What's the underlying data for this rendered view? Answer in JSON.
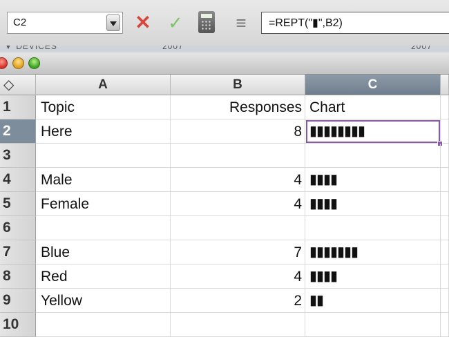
{
  "formula_bar": {
    "name_box_value": "C2",
    "formula": "=REPT(\"▮\",B2)"
  },
  "background_window": {
    "peek_left": "▼ DEVICES",
    "peek_mid": "2007",
    "peek_right": "2007"
  },
  "columns": [
    "A",
    "B",
    "C"
  ],
  "corner_glyph": "◇",
  "rows": [
    {
      "num": "1",
      "a": "Topic",
      "b": "Responses",
      "c": "Chart"
    },
    {
      "num": "2",
      "a": "Here",
      "b": "8",
      "c": "▮▮▮▮▮▮▮▮"
    },
    {
      "num": "3",
      "a": "",
      "b": "",
      "c": ""
    },
    {
      "num": "4",
      "a": "Male",
      "b": "4",
      "c": "▮▮▮▮"
    },
    {
      "num": "5",
      "a": "Female",
      "b": "4",
      "c": "▮▮▮▮"
    },
    {
      "num": "6",
      "a": "",
      "b": "",
      "c": ""
    },
    {
      "num": "7",
      "a": "Blue",
      "b": "7",
      "c": "▮▮▮▮▮▮▮"
    },
    {
      "num": "8",
      "a": "Red",
      "b": "4",
      "c": "▮▮▮▮"
    },
    {
      "num": "9",
      "a": "Yellow",
      "b": "2",
      "c": "▮▮"
    },
    {
      "num": "10",
      "a": "",
      "b": "",
      "c": ""
    }
  ],
  "selection": {
    "active_cell": "C2",
    "active_row": "2",
    "active_col": "C",
    "color": "#8a58a8"
  }
}
